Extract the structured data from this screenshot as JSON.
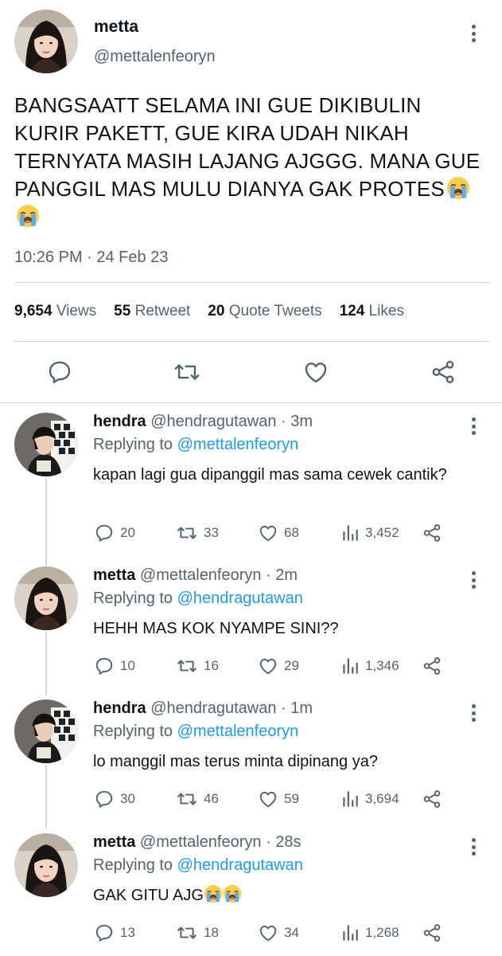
{
  "main_tweet": {
    "name": "metta",
    "handle": "@mettalenfeoryn",
    "text": "BANGSAATT SELAMA INI GUE DIKIBULIN KURIR PAKETT, GUE KIRA UDAH NIKAH TERNYATA MASIH LAJANG AJGGG. MANA GUE PANGGIL MAS MULU DIANYA GAK PROTES",
    "emojis": [
      "loudly-crying-face",
      "loudly-crying-face"
    ],
    "time": "10:26 PM · 24 Feb 23",
    "stats": {
      "views_count": "9,654",
      "views_label": "Views",
      "retweets_count": "55",
      "retweets_label": "Retweet",
      "quotes_count": "20",
      "quotes_label": "Quote Tweets",
      "likes_count": "124",
      "likes_label": "Likes"
    },
    "actions": [
      "reply-icon",
      "retweet-icon",
      "like-icon",
      "share-icon"
    ]
  },
  "replies": [
    {
      "name": "hendra",
      "handle": "@hendragutawan",
      "time": "· 3m",
      "replying_label": "Replying to",
      "replying_to": "@mettalenfeoryn",
      "text": "kapan lagi gua dipanggil mas sama cewek cantik?",
      "replies": "20",
      "retweets": "33",
      "likes": "68",
      "views": "3,452"
    },
    {
      "name": "metta",
      "handle": "@mettalenfeoryn",
      "time": "· 2m",
      "replying_label": "Replying to",
      "replying_to": "@hendragutawan",
      "text": "HEHH MAS KOK NYAMPE SINI??",
      "replies": "10",
      "retweets": "16",
      "likes": "29",
      "views": "1,346"
    },
    {
      "name": "hendra",
      "handle": "@hendragutawan",
      "time": "· 1m",
      "replying_label": "Replying to",
      "replying_to": "@mettalenfeoryn",
      "text": "lo manggil mas terus minta dipinang ya?",
      "replies": "30",
      "retweets": "46",
      "likes": "59",
      "views": "3,694"
    },
    {
      "name": "metta",
      "handle": "@mettalenfeoryn",
      "time": "· 28s",
      "replying_label": "Replying to",
      "replying_to": "@hendragutawan",
      "text": "GAK GITU AJG",
      "text_emojis": [
        "loudly-crying-face",
        "loudly-crying-face"
      ],
      "replies": "13",
      "retweets": "18",
      "likes": "34",
      "views": "1,268"
    }
  ],
  "colors": {
    "text": "#0f1419",
    "secondary": "#536471",
    "link": "#1d9bf0",
    "divider": "#cfd9de"
  }
}
